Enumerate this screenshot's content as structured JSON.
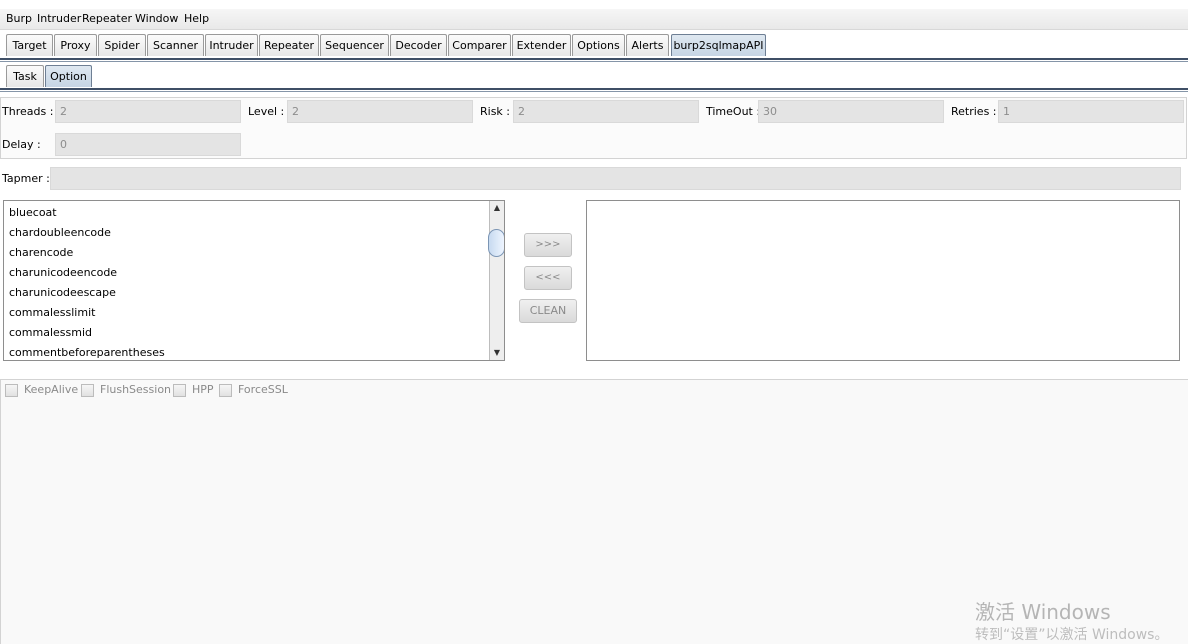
{
  "menu": [
    "Burp",
    "Intruder",
    "Repeater",
    "Window",
    "Help"
  ],
  "tabs": [
    "Target",
    "Proxy",
    "Spider",
    "Scanner",
    "Intruder",
    "Repeater",
    "Sequencer",
    "Decoder",
    "Comparer",
    "Extender",
    "Options",
    "Alerts",
    "burp2sqlmapAPI"
  ],
  "active_tab": "burp2sqlmapAPI",
  "subtabs": [
    "Task",
    "Option"
  ],
  "active_subtab": "Option",
  "fields": {
    "threads": {
      "label": "Threads :",
      "value": "2"
    },
    "level": {
      "label": "Level :",
      "value": "2"
    },
    "risk": {
      "label": "Risk :",
      "value": "2"
    },
    "timeout": {
      "label": "TimeOut :",
      "value": "30"
    },
    "retries": {
      "label": "Retries :",
      "value": "1"
    },
    "delay": {
      "label": "Delay :",
      "value": "0"
    },
    "tamper": {
      "label": "Tapmer :",
      "value": ""
    }
  },
  "tamper_list": [
    "bluecoat",
    "chardoubleencode",
    "charencode",
    "charunicodeencode",
    "charunicodeescape",
    "commalesslimit",
    "commalessmid",
    "commentbeforeparentheses"
  ],
  "buttons": {
    "add": ">>>",
    "remove": "<<<",
    "clean": "CLEAN"
  },
  "checkboxes": [
    {
      "label": "KeepAlive",
      "checked": false
    },
    {
      "label": "FlushSession",
      "checked": false
    },
    {
      "label": "HPP",
      "checked": false
    },
    {
      "label": "ForceSSL",
      "checked": false
    }
  ],
  "watermark": {
    "line1": "激活 Windows",
    "line2": "转到“设置”以激活 Windows。"
  },
  "colors": {
    "active_tab": "#c6d5e4",
    "rule": "#3f4f66"
  }
}
